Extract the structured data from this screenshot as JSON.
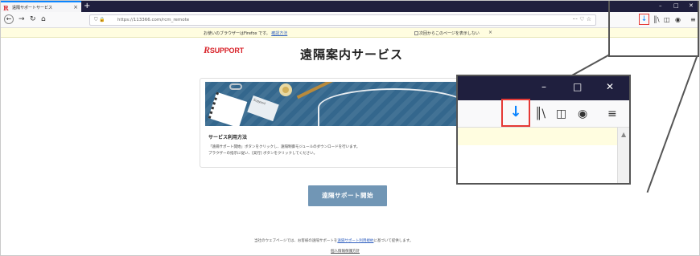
{
  "browser": {
    "tab_title": "遠隔サポートサービス",
    "tab_favicon": "R",
    "tab_close": "×",
    "new_tab": "+",
    "window_controls": [
      "–",
      "□",
      "✕"
    ],
    "url": "https://113366.com/rcm_remote",
    "nav_icons": {
      "back": "back-arrow-icon",
      "forward": "forward-arrow-icon",
      "reload": "reload-icon",
      "home": "home-icon"
    },
    "toolbar_icons": [
      "download-icon",
      "library-icon",
      "sidebar-icon",
      "account-icon",
      "menu-icon"
    ],
    "accent_color": "#0a84ff",
    "highlight_color": "#e53935"
  },
  "notification": {
    "message": "お使いのブラウザーはFirefox です。",
    "link": "確認方法",
    "checkbox_label": "次回からこのページを表示しない",
    "close": "×"
  },
  "page": {
    "logo_r": "R",
    "logo_text": "SUPPORT",
    "logo_color": "#d8232a",
    "title": "遠隔案内サービス",
    "hero_notebook_text": "Support",
    "info_title": "サービス利用方法",
    "info_lines": [
      "「遠隔サポート開始」ボタンをクリックし、遠隔制御モジュールのダウンロードを行います。",
      "ブラウザーの指示に従い、[実行] ボタンをクリックしてください。"
    ],
    "start_button": "遠隔サポート開始",
    "start_button_color": "#7196b5",
    "footer_text_1": "当社のウェブページでは、お客様の遠隔サポートを",
    "footer_link": "遠隔サポート利用規約",
    "footer_text_2": "に基づいて提供します。",
    "privacy_link": "個人情報保護方針"
  }
}
